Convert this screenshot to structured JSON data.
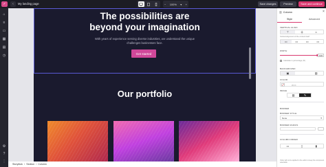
{
  "topbar": {
    "logo_glyph": "✓",
    "back_glyph": "‹",
    "page_name": "My landing page",
    "devices": [
      "desktop-icon",
      "tablet-icon",
      "mobile-icon"
    ],
    "active_device": "desktop",
    "zoom": {
      "minus": "−",
      "value": "100%",
      "chevron": "▾",
      "plus": "+"
    },
    "save_label": "Save changes",
    "preview_label": "Preview",
    "publish_label": "Save and continue"
  },
  "leftbar": {
    "items": [
      "home-icon",
      "layers-icon",
      "pages-icon",
      "grid-icon",
      "library-icon",
      "history-icon"
    ],
    "bottom": [
      "settings-icon",
      "help-icon",
      "more-icon"
    ]
  },
  "canvas": {
    "hero_title_line1": "The possibilities are",
    "hero_title_line2": "beyond your imagination",
    "hero_subtitle": "With years of experience serving diverse industries, we understand the unique challenges businesses face.",
    "cta_label": "Get started",
    "section_title": "Our portfolio"
  },
  "breadcrumb": [
    "Storyblok",
    "›",
    "Section",
    "›",
    "Column"
  ],
  "panel": {
    "title": "Column",
    "close_glyph": "×",
    "tabs": [
      "Style",
      "Advanced"
    ],
    "active_tab": "Style",
    "vertical_align_label": "VERTICAL ALIGN",
    "vertical_align_hint": "Vertical alignment of the content itself",
    "width_label": "WIDTH",
    "width_value": "100",
    "width_percent": 100,
    "width_checkbox_label": "Calculate in percentage (%)",
    "background_label": "BACKGROUND",
    "color_label": "COLOR",
    "color_placeholder": "#FFF",
    "image_label": "IMAGE",
    "border_label": "BORDER",
    "border_style_label": "BORDER STYLE",
    "border_style_value": "None",
    "border_radius_label": "BORDER RADIUS",
    "column_order_label": "COLUMN ORDER",
    "note": "Order will not be applied to the editor to keep the component selectable."
  },
  "colors": {
    "accent": "#d9386f",
    "cta": "#d0489a",
    "page_bg": "#1a1a2e",
    "selection": "#5b5bd6"
  }
}
